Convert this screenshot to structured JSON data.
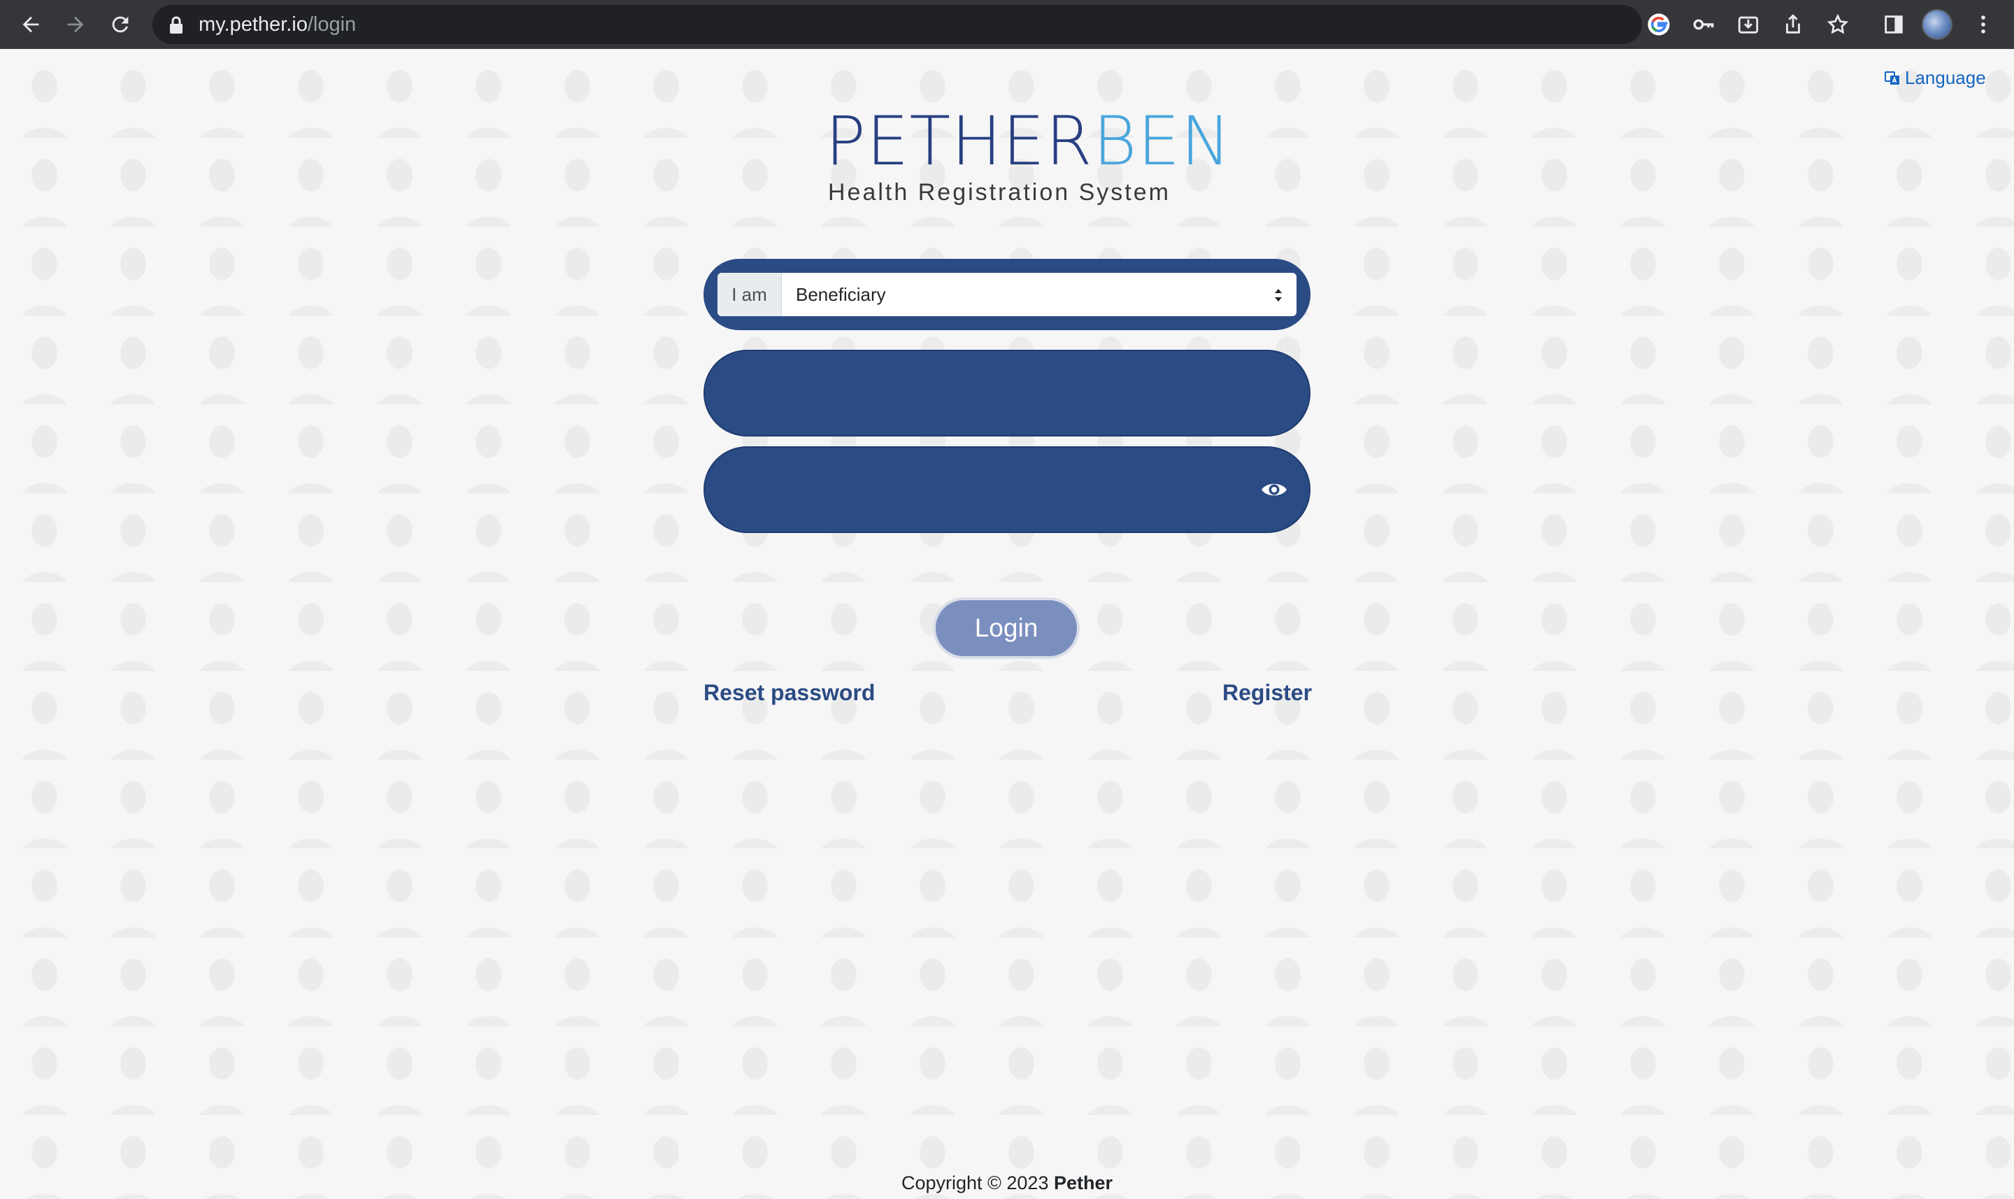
{
  "browser": {
    "url_host": "my.pether.io",
    "url_path": "/login",
    "icons": [
      "back-arrow-icon",
      "forward-arrow-icon",
      "reload-icon",
      "lock-icon",
      "google-icon",
      "key-icon",
      "install-icon",
      "share-icon",
      "star-icon",
      "side-panel-icon",
      "profile-avatar",
      "more-vert-icon"
    ]
  },
  "header": {
    "language_label": "Language"
  },
  "logo": {
    "title_dark": "PETHER",
    "title_light": "BEN",
    "subtitle": "Health Registration System"
  },
  "form": {
    "role_prefix": "I am",
    "role_selected": "Beneficiary",
    "username_value": "",
    "password_value": "",
    "login_label": "Login",
    "reset_password_label": "Reset password",
    "register_label": "Register"
  },
  "footer": {
    "copyright_prefix": "Copyright © 2023",
    "copyright_owner": "Pether"
  },
  "colors": {
    "brand_dark": "#2b4b84",
    "brand_light": "#4aa6dc",
    "login_button": "#7b8fbf",
    "link": "#2b4b84"
  }
}
